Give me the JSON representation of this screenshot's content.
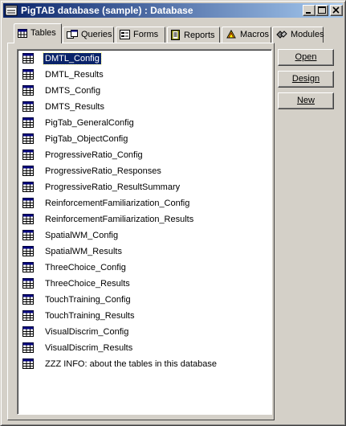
{
  "window": {
    "title": "PigTAB database (sample) : Database"
  },
  "tabs": [
    {
      "label": "Tables",
      "icon": "table-icon"
    },
    {
      "label": "Queries",
      "icon": "queries-icon"
    },
    {
      "label": "Forms",
      "icon": "forms-icon"
    },
    {
      "label": "Reports",
      "icon": "reports-icon"
    },
    {
      "label": "Macros",
      "icon": "macros-icon"
    },
    {
      "label": "Modules",
      "icon": "modules-icon"
    }
  ],
  "buttons": {
    "open": "Open",
    "design": "Design",
    "new": "New"
  },
  "tables": [
    "DMTL_Config",
    "DMTL_Results",
    "DMTS_Config",
    "DMTS_Results",
    "PigTab_GeneralConfig",
    "PigTab_ObjectConfig",
    "ProgressiveRatio_Config",
    "ProgressiveRatio_Responses",
    "ProgressiveRatio_ResultSummary",
    "ReinforcementFamiliarization_Config",
    "ReinforcementFamiliarization_Results",
    "SpatialWM_Config",
    "SpatialWM_Results",
    "ThreeChoice_Config",
    "ThreeChoice_Results",
    "TouchTraining_Config",
    "TouchTraining_Results",
    "VisualDiscrim_Config",
    "VisualDiscrim_Results",
    "ZZZ INFO: about the tables in this database"
  ],
  "selected_table": "DMTL_Config",
  "colors": {
    "title_start": "#0a246a",
    "title_end": "#a6caf0",
    "selection": "#0a246a"
  }
}
